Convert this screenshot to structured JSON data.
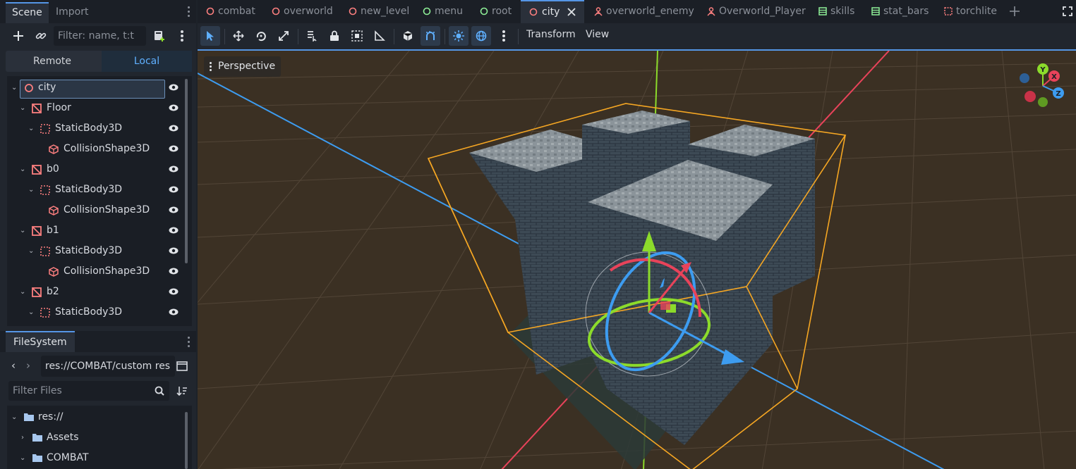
{
  "scene_dock": {
    "tabs": [
      "Scene",
      "Import"
    ],
    "filter_placeholder": "Filter: name, t:t",
    "remote_label": "Remote",
    "local_label": "Local",
    "tree": [
      {
        "label": "city",
        "icon": "node3d-circle-icon",
        "depth": 0,
        "selected": true
      },
      {
        "label": "Floor",
        "icon": "csg-mesh-icon",
        "depth": 1
      },
      {
        "label": "StaticBody3D",
        "icon": "static-body-icon",
        "depth": 2
      },
      {
        "label": "CollisionShape3D",
        "icon": "collision-shape-icon",
        "depth": 3
      },
      {
        "label": "b0",
        "icon": "csg-mesh-icon",
        "depth": 1
      },
      {
        "label": "StaticBody3D",
        "icon": "static-body-icon",
        "depth": 2
      },
      {
        "label": "CollisionShape3D",
        "icon": "collision-shape-icon",
        "depth": 3
      },
      {
        "label": "b1",
        "icon": "csg-mesh-icon",
        "depth": 1
      },
      {
        "label": "StaticBody3D",
        "icon": "static-body-icon",
        "depth": 2
      },
      {
        "label": "CollisionShape3D",
        "icon": "collision-shape-icon",
        "depth": 3
      },
      {
        "label": "b2",
        "icon": "csg-mesh-icon",
        "depth": 1
      },
      {
        "label": "StaticBody3D",
        "icon": "static-body-icon",
        "depth": 2
      }
    ]
  },
  "filesystem_dock": {
    "title": "FileSystem",
    "path": "res://COMBAT/custom res",
    "filter_placeholder": "Filter Files",
    "items": [
      {
        "label": "res://",
        "expanded": true
      },
      {
        "label": "Assets",
        "expanded": false
      },
      {
        "label": "COMBAT",
        "expanded": true
      }
    ]
  },
  "scene_tabs": [
    {
      "label": "combat",
      "icon": "circle-red-icon"
    },
    {
      "label": "overworld",
      "icon": "circle-red-icon"
    },
    {
      "label": "new_level",
      "icon": "circle-red-icon"
    },
    {
      "label": "menu",
      "icon": "circle-green-icon"
    },
    {
      "label": "root",
      "icon": "circle-green-icon"
    },
    {
      "label": "city",
      "icon": "circle-red-icon",
      "active": true
    },
    {
      "label": "overworld_enemy",
      "icon": "character-icon"
    },
    {
      "label": "Overworld_Player",
      "icon": "character-icon"
    },
    {
      "label": "skills",
      "icon": "grid-green-icon"
    },
    {
      "label": "stat_bars",
      "icon": "grid-green-icon"
    },
    {
      "label": "torchlite",
      "icon": "dashed-square-icon"
    }
  ],
  "viewport_toolbar": {
    "transform_menu": "Transform",
    "view_menu": "View"
  },
  "viewport": {
    "perspective_label": "Perspective",
    "gizmo_axes": [
      "Y",
      "X",
      "Z"
    ]
  },
  "colors": {
    "accent": "#5596e6",
    "axis_x": "#e8435a",
    "axis_y": "#8cdb2b",
    "axis_z": "#3d9cf0",
    "selection_box": "#f5a623"
  }
}
